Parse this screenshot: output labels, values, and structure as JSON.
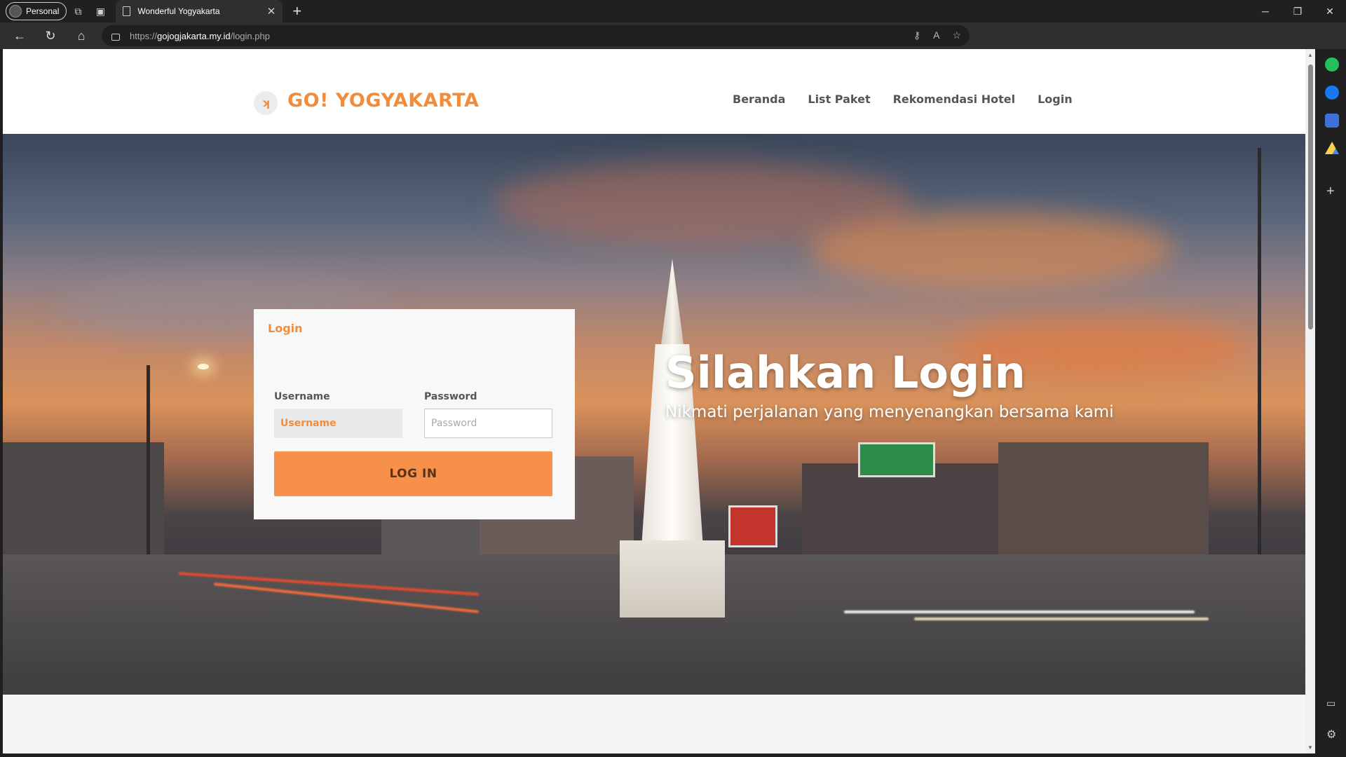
{
  "browser": {
    "profile_label": "Personal",
    "tab_title": "Wonderful Yogyakarta",
    "url_scheme": "https://",
    "url_domain": "gojogjakarta.my.id",
    "url_path": "/login.php"
  },
  "page": {
    "comment_text": "-->",
    "brand": "GO! YOGYAKARTA",
    "logo_glyph": "ʞ",
    "menu": [
      {
        "label": "Beranda"
      },
      {
        "label": "List Paket"
      },
      {
        "label": "Rekomendasi Hotel"
      },
      {
        "label": "Login"
      }
    ],
    "hero": {
      "title": "Silahkan Login",
      "subtitle": "Nikmati perjalanan yang menyenangkan bersama kami"
    },
    "login": {
      "heading": "Login",
      "username_label": "Username",
      "username_placeholder": "Username",
      "password_label": "Password",
      "password_placeholder": "Password",
      "submit_label": "LOG IN"
    }
  },
  "colors": {
    "accent": "#f28c3a",
    "button": "#f6904b"
  }
}
